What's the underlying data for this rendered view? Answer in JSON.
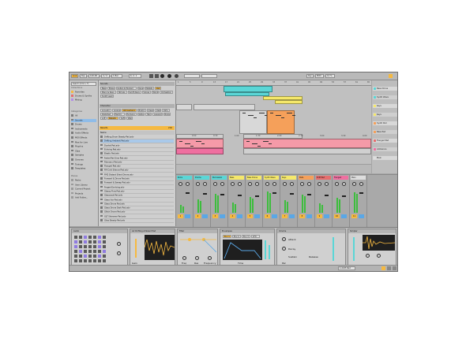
{
  "transport": {
    "link": "Link",
    "tap": "Tap",
    "tempo": "120.00",
    "signature": "4 / 4",
    "bar_mode": "1 Bar",
    "position": "6. 2. 1",
    "key": "Key",
    "midi": "MIDI",
    "cpu": "12 %"
  },
  "browser": {
    "search_placeholder": "Search (Cmd + F)",
    "collections_label": "Collections",
    "collections": [
      {
        "label": "Favorites",
        "color": "#f5b941"
      },
      {
        "label": "Drums & Synths",
        "color": "#e66e6e"
      },
      {
        "label": "Mixing",
        "color": "#b48de6"
      }
    ],
    "categories_label": "Categories",
    "categories": [
      "All",
      "Sounds",
      "Drums",
      "Instruments",
      "Audio Effects",
      "MIDI Effects",
      "Max for Live",
      "Plug-Ins",
      "Clips",
      "Samples",
      "Grooves",
      "Tunings",
      "Templates"
    ],
    "places_label": "Places",
    "places": [
      "Packs",
      "User Library",
      "Current Project",
      "Projects",
      "Add Folder..."
    ],
    "selected_category_index": 1
  },
  "filter": {
    "sounds_label": "Sounds",
    "sound_tags": [
      "Bass",
      "Brass",
      "Guitar & Plucked",
      "Keys",
      "Mallets",
      "Pad",
      "Piano & Keys",
      "Strings",
      "Synth Keys",
      "Voices",
      "Winds",
      "Orchestral",
      "Synth Lead"
    ],
    "selected_sound_tag": 5,
    "character_label": "Character",
    "character_tags": [
      "Acoustic",
      "Analog",
      "Atmospheric",
      "Bright",
      "Clean",
      "Dark",
      "Dirty",
      "Distorted",
      "Electric",
      "Evolving",
      "Glide",
      "Hard",
      "Layered",
      "Noisy",
      "Lofi",
      "Metallic",
      "Soft",
      "Warm"
    ],
    "selected_character_tags": [
      2,
      15
    ],
    "results_label": "Results",
    "results_count": "216",
    "name_header": "Name",
    "results": [
      "Drifting Drum Steady Pad.adv",
      "Drifting Ambient Pad.adv",
      "Dunkel Pad.adv",
      "Echoing Pad.adv",
      "Elastic Pad.adv",
      "Faded Pad Sine Pad.adv",
      "Fibonacci Pad.adv",
      "Flanged Pad.adv",
      "FM Cold Silence Pad.adv",
      "FM2 Distant Silent Drone.adv",
      "Forward & Drone Pad.adv",
      "Forward & Sweep Pad.adv",
      "Fraged Evolving.adv",
      "Glassy Flow Pad.adv",
      "Glassnaut Pad.adv",
      "Glass Vox Pad.adv",
      "Glass Drone Pad.adv",
      "Glass Drone Dark Pad.adv",
      "Glitch Drone Pad.adv",
      "GLT Shimmer Pad.adv",
      "Gliss Steady Pad.adv"
    ],
    "selected_result_index": 1
  },
  "arrangement": {
    "ruler": [
      "1",
      "5",
      "9",
      "13",
      "17",
      "21",
      "25",
      "29",
      "33",
      "37",
      "41",
      "45",
      "49",
      "53",
      "57",
      "61",
      "65"
    ],
    "time_markers": [
      "0:00",
      "0:30",
      "1:00",
      "1:30",
      "2:00",
      "2:30",
      "3:00",
      "3:30",
      "4:00"
    ]
  },
  "tracks": [
    {
      "label": "Bass Drone",
      "color": "#5ad6d6"
    },
    {
      "label": "Synth Wave",
      "color": "#5ad6d6"
    },
    {
      "label": "Keys",
      "color": "#f5e86a"
    },
    {
      "label": "Keys",
      "color": "#f5e86a"
    },
    {
      "label": "Synth Pad",
      "color": "#f5a05a"
    },
    {
      "label": "Bass Pad",
      "color": "#f5a05a"
    },
    {
      "label": "Flanged Pad",
      "color": "#e66e6e"
    },
    {
      "label": "Ambience",
      "color": "#ef6fa0"
    },
    {
      "label": "Main",
      "color": "#dddddd"
    }
  ],
  "mixer": {
    "channels": [
      {
        "name": "Kicks",
        "color": "#5ad6d6",
        "num": "1"
      },
      {
        "name": "Drums",
        "color": "#5ad6d6",
        "num": "2"
      },
      {
        "name": "Percussion",
        "color": "#5ad6d6",
        "num": "3"
      },
      {
        "name": "Bass",
        "color": "#f5e86a",
        "num": "4"
      },
      {
        "name": "Bass Drone",
        "color": "#f5e86a",
        "num": "5"
      },
      {
        "name": "Synth Wave",
        "color": "#f5e86a",
        "num": "6"
      },
      {
        "name": "Keys",
        "color": "#f5e86a",
        "num": "7"
      },
      {
        "name": "Pads",
        "color": "#f5a05a",
        "num": "8"
      },
      {
        "name": "Drift Pad",
        "color": "#e66e6e",
        "num": "9"
      },
      {
        "name": "Flanged",
        "color": "#ef6fa0",
        "num": "10"
      },
      {
        "name": "Main",
        "color": "#dddddd",
        "num": "11"
      }
    ]
  },
  "devices": {
    "drum_rack_title": "Audio",
    "pad_title": "Air Drifting Ambient Pad",
    "osc_title": "Wavetable",
    "filter_title": "Filter",
    "env_title": "Envelopes",
    "env_tabs": [
      "Env 1",
      "Env 2",
      "Env 3",
      "LFO"
    ],
    "sample_title": "Simpler",
    "labels": {
      "freq": "Freq",
      "res": "Res",
      "frequency": "Frequency",
      "time": "Time",
      "attack": "Attack",
      "decay": "Decay",
      "sustain": "Sustain",
      "release": "Release",
      "gain": "Gain",
      "volume": "Volume",
      "pan": "Pan"
    }
  },
  "status_bar": {
    "track_label": "1-Drift Pad"
  },
  "colors": {
    "accent": "#f5b941",
    "cyan": "#5ad6d6",
    "yellow": "#f5e86a",
    "orange": "#f5a05a",
    "pink": "#ef6fa0",
    "red": "#e66e6e",
    "purple": "#8f7be0"
  }
}
